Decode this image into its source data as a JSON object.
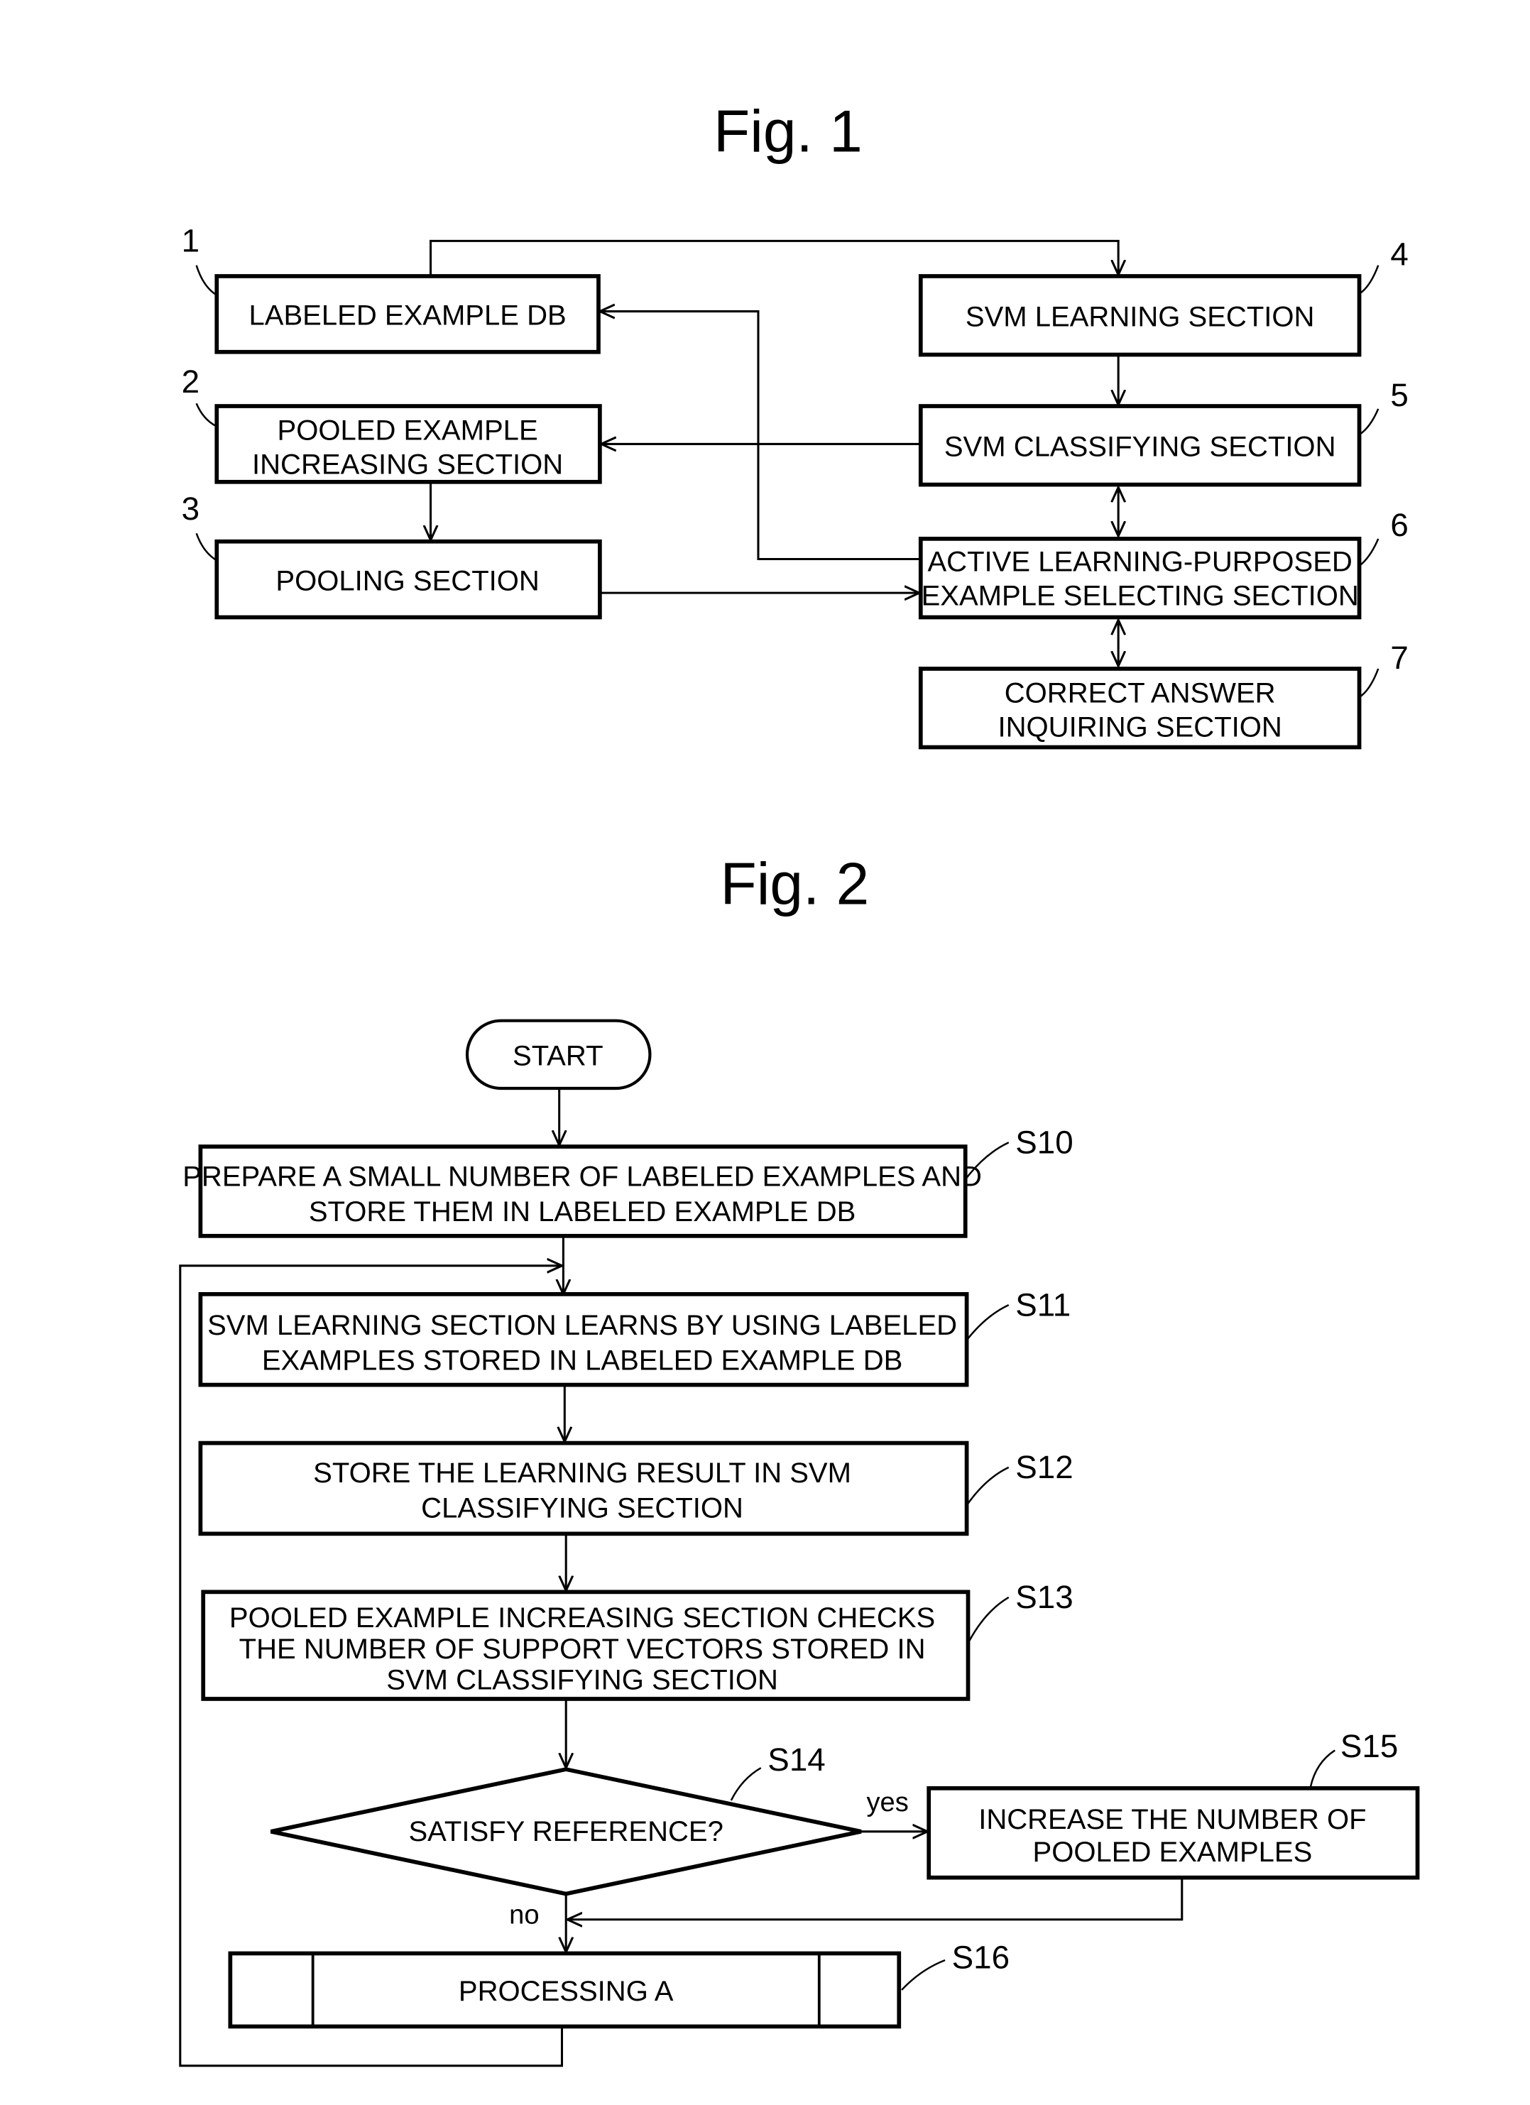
{
  "fig1": {
    "title": "Fig. 1",
    "blocks": [
      {
        "ref": "1",
        "lines": [
          "LABELED EXAMPLE DB"
        ]
      },
      {
        "ref": "2",
        "lines": [
          "POOLED EXAMPLE",
          "INCREASING SECTION"
        ]
      },
      {
        "ref": "3",
        "lines": [
          "POOLING SECTION"
        ]
      },
      {
        "ref": "4",
        "lines": [
          "SVM LEARNING SECTION"
        ]
      },
      {
        "ref": "5",
        "lines": [
          "SVM CLASSIFYING SECTION"
        ]
      },
      {
        "ref": "6",
        "lines": [
          "ACTIVE LEARNING-PURPOSED",
          "EXAMPLE SELECTING SECTION"
        ]
      },
      {
        "ref": "7",
        "lines": [
          "CORRECT ANSWER",
          "INQUIRING SECTION"
        ]
      }
    ]
  },
  "fig2": {
    "title": "Fig. 2",
    "start": "START",
    "steps": [
      {
        "id": "S10",
        "lines": [
          "PREPARE A SMALL NUMBER OF LABELED EXAMPLES AND",
          "STORE THEM IN LABELED EXAMPLE DB"
        ]
      },
      {
        "id": "S11",
        "lines": [
          "SVM LEARNING SECTION LEARNS BY USING LABELED",
          "EXAMPLES STORED IN LABELED EXAMPLE DB"
        ]
      },
      {
        "id": "S12",
        "lines": [
          "STORE THE LEARNING RESULT IN SVM",
          "CLASSIFYING SECTION"
        ]
      },
      {
        "id": "S13",
        "lines": [
          "POOLED EXAMPLE INCREASING SECTION CHECKS",
          "THE NUMBER OF SUPPORT VECTORS STORED IN",
          "SVM CLASSIFYING SECTION"
        ]
      },
      {
        "id": "S14",
        "lines": [
          "SATISFY REFERENCE?"
        ]
      },
      {
        "id": "S15",
        "lines": [
          "INCREASE THE NUMBER OF",
          "POOLED EXAMPLES"
        ]
      },
      {
        "id": "S16",
        "lines": [
          "PROCESSING A"
        ]
      }
    ],
    "branch_yes": "yes",
    "branch_no": "no"
  }
}
